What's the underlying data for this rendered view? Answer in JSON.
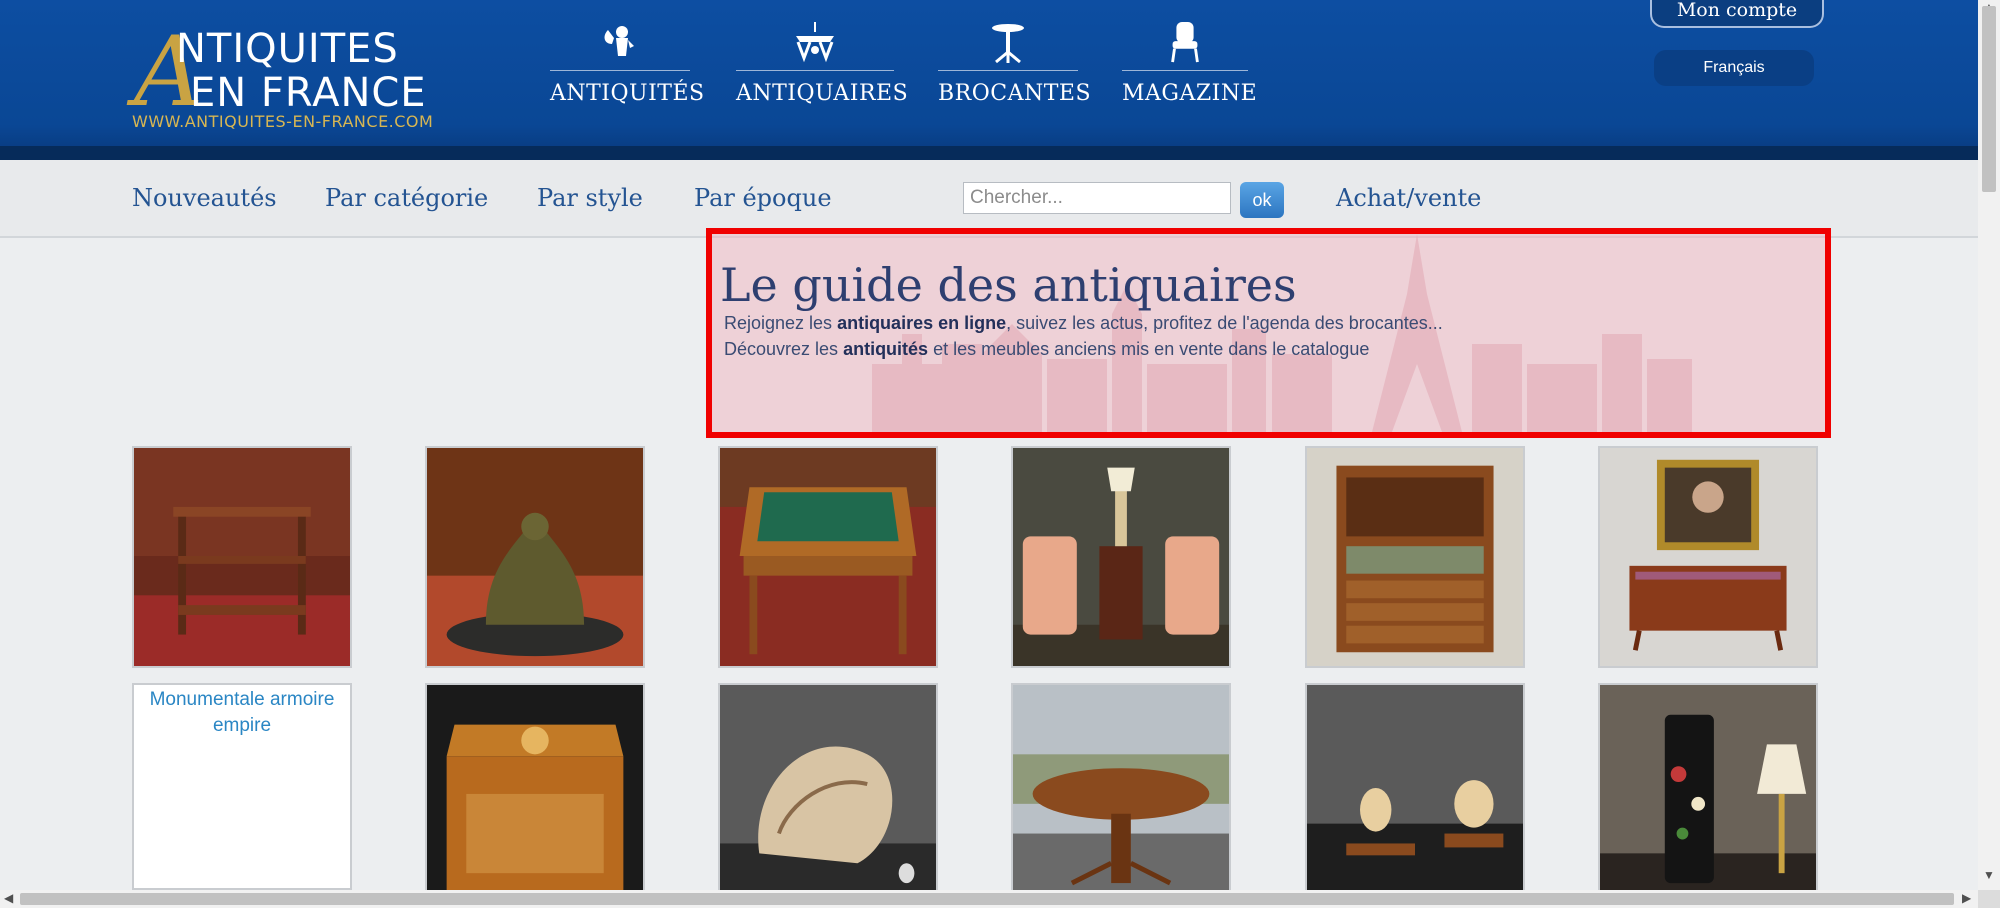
{
  "header": {
    "logo": {
      "big_letter": "A",
      "line1": "NTIQUITES",
      "line2": "EN FRANCE",
      "url": "WWW.ANTIQUITES-EN-FRANCE.COM"
    },
    "nav": [
      {
        "label": "ANTIQUITÉS",
        "icon": "cherub-icon"
      },
      {
        "label": "ANTIQUAIRES",
        "icon": "chandelier-icon"
      },
      {
        "label": "BROCANTES",
        "icon": "gueridon-table-icon"
      },
      {
        "label": "MAGAZINE",
        "icon": "armchair-icon"
      }
    ],
    "account_label": "Mon compte",
    "language": "Français"
  },
  "subnav": {
    "items": [
      "Nouveautés",
      "Par catégorie",
      "Par style",
      "Par époque"
    ],
    "search_placeholder": "Chercher...",
    "ok_label": "ok",
    "buy_sell": "Achat/vente"
  },
  "hero": {
    "title": "Le guide des antiquaires",
    "line1_pre": "Rejoignez les ",
    "line1_bold": "antiquaires en ligne",
    "line1_post": ", suivez les actus, profitez de l'agenda des brocantes...",
    "line2_pre": "Découvrez les ",
    "line2_bold": "antiquités",
    "line2_post": " et les meubles anciens mis en vente dans le catalogue"
  },
  "products": {
    "broken_image_alt": "Monumentale armoire empire"
  },
  "colors": {
    "header_blue": "#0d4ea2",
    "gold": "#c9a343",
    "nav_text": "#245492",
    "highlight_border": "#f00000"
  }
}
